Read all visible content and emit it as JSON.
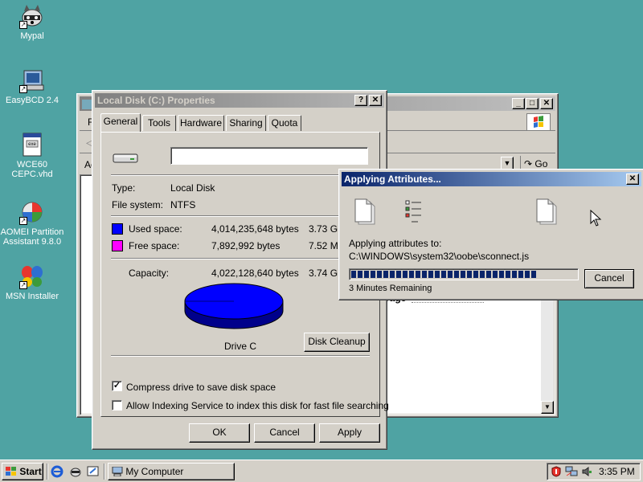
{
  "desktop": {
    "icons": [
      {
        "label": "Mypal"
      },
      {
        "label": "EasyBCD 2.4"
      },
      {
        "label": "WCE60 CEPC.vhd"
      },
      {
        "label": "AOMEI Partition Assistant 9.8.0"
      },
      {
        "label": "MSN Installer"
      }
    ]
  },
  "explorer": {
    "go_label": "Go",
    "menu_first": "F",
    "address_first": "Ac",
    "left_frag": "( ",
    "bg_text": "rage"
  },
  "properties": {
    "title": "Local Disk (C:) Properties",
    "tabs": [
      "General",
      "Tools",
      "Hardware",
      "Sharing",
      "Quota"
    ],
    "volume_label": "",
    "type_label": "Type:",
    "type_value": "Local Disk",
    "fs_label": "File system:",
    "fs_value": "NTFS",
    "used_label": "Used space:",
    "used_bytes": "4,014,235,648 bytes",
    "used_gb": "3.73 GB",
    "free_label": "Free space:",
    "free_bytes": "7,892,992 bytes",
    "free_gb": "7.52 MB",
    "capacity_label": "Capacity:",
    "capacity_bytes": "4,022,128,640 bytes",
    "capacity_gb": "3.74 GB",
    "drive_label": "Drive C",
    "cleanup_button": "Disk Cleanup",
    "compress_label": "Compress drive to save disk space",
    "compress_checked": true,
    "index_label": "Allow Indexing Service to index this disk for fast file searching",
    "index_checked": false,
    "ok_button": "OK",
    "cancel_button": "Cancel",
    "apply_button": "Apply",
    "used_color": "#0000ff",
    "free_color": "#ff00ff"
  },
  "applying": {
    "title": "Applying Attributes...",
    "status_label": "Applying attributes to:",
    "path": "C:\\WINDOWS\\system32\\oobe\\sconnect.js",
    "remaining": "3 Minutes Remaining",
    "cancel_button": "Cancel",
    "progress": 0.82
  },
  "taskbar": {
    "start_label": "Start",
    "task_label": "My Computer",
    "clock": "3:35 PM"
  }
}
